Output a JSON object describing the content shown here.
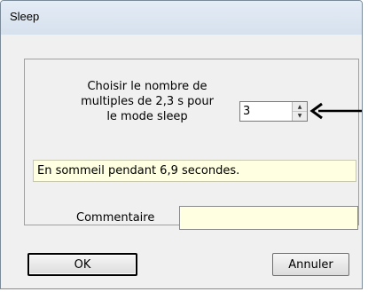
{
  "window": {
    "title": "Sleep"
  },
  "form": {
    "prompt_line1": "Choisir le nombre de",
    "prompt_line2": "multiples de 2,3 s pour",
    "prompt_line3": "le mode sleep",
    "multiples_value": "3",
    "status_text": "En sommeil pendant 6,9 secondes.",
    "comment_label": "Commentaire",
    "comment_value": ""
  },
  "buttons": {
    "ok_label": "OK",
    "cancel_label": "Annuler"
  },
  "icons": {
    "spin_up": "spin-up-icon",
    "spin_down": "spin-down-icon",
    "annotation_arrow": "arrow-left-icon"
  },
  "colors": {
    "status_background": "#ffffe1",
    "comment_background": "#ffffe1"
  }
}
